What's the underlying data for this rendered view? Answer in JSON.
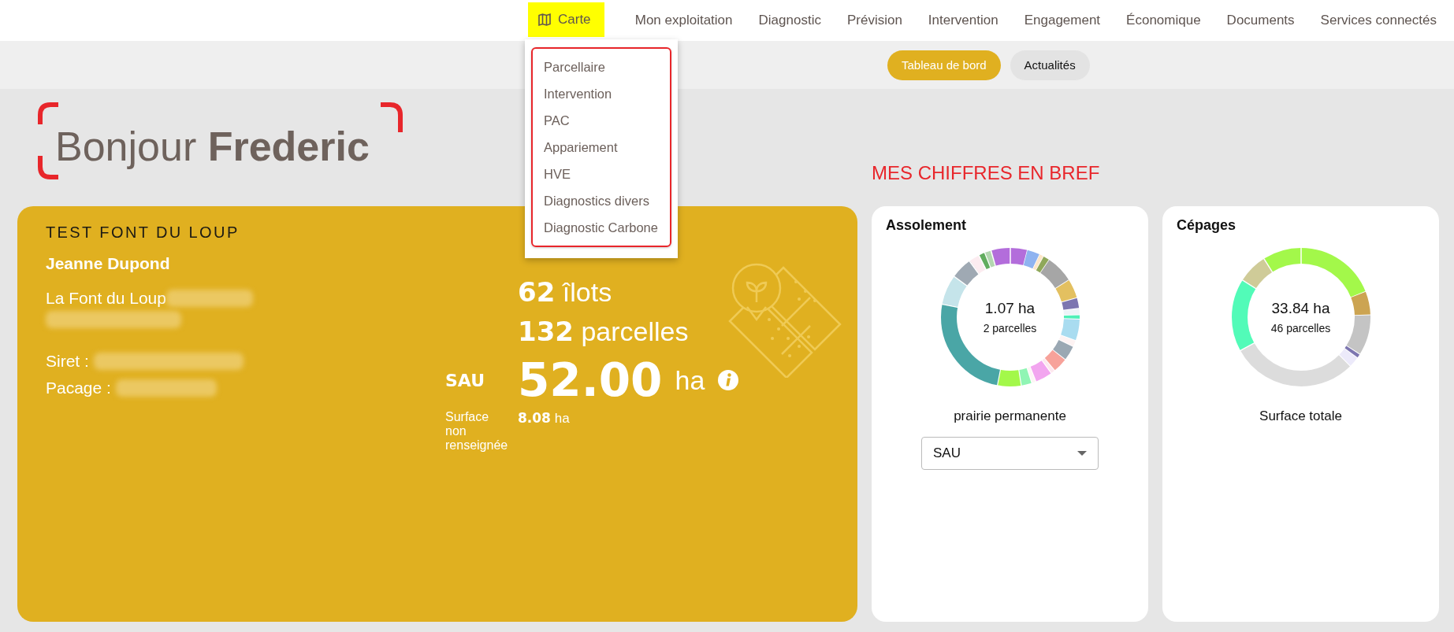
{
  "top_nav": {
    "items": [
      {
        "label": "Carte",
        "kind": "icon",
        "selected": true
      },
      {
        "label": "Mon exploitation",
        "selected": false
      },
      {
        "label": "Diagnostic",
        "selected": false
      },
      {
        "label": "Prévision",
        "selected": false
      },
      {
        "label": "Intervention",
        "selected": false
      },
      {
        "label": "Engagement",
        "selected": false
      },
      {
        "label": "Économique",
        "selected": false
      },
      {
        "label": "Documents",
        "selected": false
      },
      {
        "label": "Services connectés",
        "selected": false
      }
    ]
  },
  "menu": {
    "items": [
      "Parcellaire",
      "Intervention",
      "PAC",
      "Appariement",
      "HVE",
      "Diagnostics divers",
      "Diagnostic Carbone"
    ]
  },
  "sub_tabs": [
    {
      "label": "Tableau de bord",
      "selected": true
    },
    {
      "label": "Actualités",
      "selected": false
    }
  ],
  "greeting": {
    "text": "Bonjour",
    "name": "Frederic"
  },
  "section_title": "MES CHIFFRES EN BREF",
  "farm_card": {
    "title": "TEST FONT DU LOUP",
    "owner": "Jeanne Dupond",
    "address": "La Font du Loup",
    "siret_label": "Siret :",
    "pacage_label": "Pacage :",
    "counts": [
      {
        "value": "62",
        "unit": "îlots"
      },
      {
        "value": "132",
        "unit": "parcelles"
      }
    ],
    "sau": {
      "label": "SAU",
      "value": "52.00",
      "unit": "ha"
    },
    "unfilled": {
      "label": "Surface non renseignée",
      "value": "8.08",
      "unit": "ha"
    }
  },
  "cards": [
    {
      "title": "Assolement",
      "total": "1.07 ha",
      "count": "2 parcelles",
      "caption": "prairie permanente",
      "select": {
        "value": "SAU"
      }
    },
    {
      "title": "Cépages",
      "total": "33.84 ha",
      "count": "46 parcelles",
      "caption": "Surface totale"
    }
  ]
}
